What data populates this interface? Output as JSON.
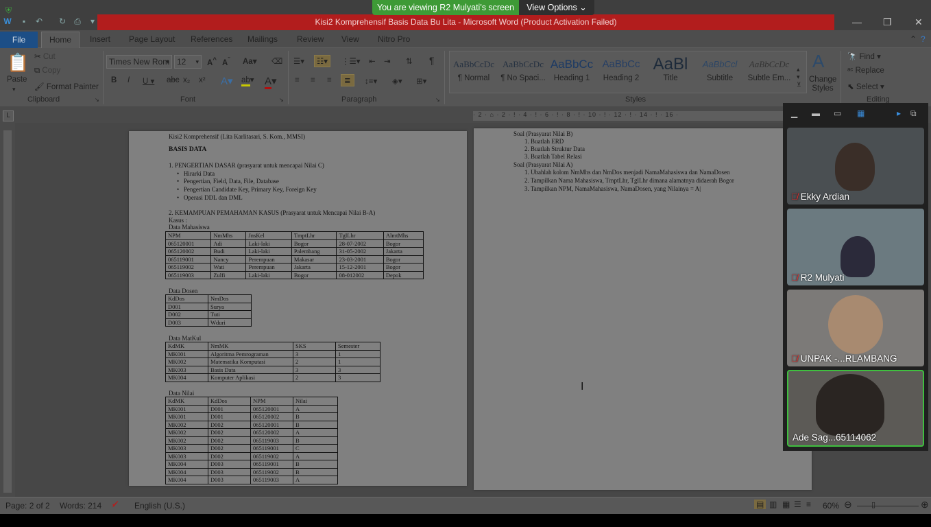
{
  "share": {
    "banner": "You are viewing R2 Mulyati's screen",
    "view_options": "View Options"
  },
  "window": {
    "title": "Kisi2 Komprehensif Basis Data Bu Lita - Microsoft Word (Product Activation Failed)"
  },
  "tabs": [
    "File",
    "Home",
    "Insert",
    "Page Layout",
    "References",
    "Mailings",
    "Review",
    "View",
    "Nitro Pro"
  ],
  "ribbon": {
    "clipboard": {
      "label": "Clipboard",
      "paste": "Paste",
      "cut": "Cut",
      "copy": "Copy",
      "format_painter": "Format Painter"
    },
    "font": {
      "label": "Font",
      "name": "Times New Rom",
      "size": "12"
    },
    "paragraph": {
      "label": "Paragraph"
    },
    "styles": {
      "label": "Styles",
      "items": [
        {
          "preview": "AaBbCcDc",
          "name": "¶ Normal"
        },
        {
          "preview": "AaBbCcDc",
          "name": "¶ No Spaci..."
        },
        {
          "preview": "AaBbCc",
          "name": "Heading 1"
        },
        {
          "preview": "AaBbCc",
          "name": "Heading 2"
        },
        {
          "preview": "AaBl",
          "name": "Title"
        },
        {
          "preview": "AaBbCcl",
          "name": "Subtitle"
        },
        {
          "preview": "AaBbCcDc",
          "name": "Subtle Em..."
        }
      ],
      "change_styles": "Change Styles"
    },
    "editing": {
      "label": "Editing",
      "find": "Find",
      "replace": "Replace",
      "select": "Select"
    }
  },
  "ruler": {
    "marks": "· 2 · ⌂ · 2 · ! · 4 · ! · 6 · ! · 8 · ! · 10 · ! · 12 · ! · 14 · ! · 16 ·"
  },
  "page1": {
    "header": "Kisi2 Komprehensif (Lita Karlitasari, S. Kom., MMSI)",
    "title": "BASIS DATA",
    "sec1": "1. PENGERTIAN DASAR (prasyarat untuk mencapai Nilai C)",
    "bullets": [
      "Hirarki Data",
      "Pengertian, Field, Data, File, Database",
      "Pengertian Candidate Key, Primary Key, Foreign Key",
      "Operasi  DDL dan DML"
    ],
    "sec2": "2. KEMAMPUAN PEMAHAMAN KASUS (Prasyarat untuk Mencapai Nilai B-A)",
    "kasus": "Kasus :",
    "mhs_title": "Data Mahasiswa",
    "mhs_header": [
      "NPM",
      "NmMhs",
      "JnsKel",
      "TmptLhr",
      "TglLhr",
      "AlmtMhs"
    ],
    "mhs_rows": [
      [
        "065120001",
        "Adi",
        "Laki-laki",
        "Bogor",
        "28-07-2002",
        "Bogor"
      ],
      [
        "065120002",
        "Budi",
        "Laki-laki",
        "Palembang",
        "31-05-2002",
        "Jakarta"
      ],
      [
        "065119001",
        "Nancy",
        "Perempuan",
        "Makasar",
        "23-03-2001",
        "Bogor"
      ],
      [
        "065119002",
        "Wati",
        "Perempuan",
        "Jakarta",
        "15-12-2001",
        "Bogor"
      ],
      [
        "065119003",
        "Zulfi",
        "Laki-laki",
        "Bogor",
        "08-012002",
        "Depok"
      ]
    ],
    "dosen_title": "Data Dosen",
    "dosen_header": [
      "KdDos",
      "NmDos"
    ],
    "dosen_rows": [
      [
        "D001",
        "Surya"
      ],
      [
        "D002",
        "Tuti"
      ],
      [
        "D003",
        "Wduri"
      ]
    ],
    "mk_title": "Data MatKul",
    "mk_header": [
      "KdMK",
      "NmMK",
      "SKS",
      "Semester"
    ],
    "mk_rows": [
      [
        "MK001",
        "Algoritma Pemrograman",
        "3",
        "1"
      ],
      [
        "MK002",
        "Matematika Komputasi",
        "2",
        "1"
      ],
      [
        "MK003",
        "Basis Data",
        "3",
        "3"
      ],
      [
        "MK004",
        "Komputer Aplikasi",
        "2",
        "3"
      ]
    ],
    "nilai_title": "Data Nilai",
    "nilai_header": [
      "KdMK",
      "KdDos",
      "NPM",
      "Nilai"
    ],
    "nilai_rows": [
      [
        "MK001",
        "D001",
        "065120001",
        "A"
      ],
      [
        "MK001",
        "D001",
        "065120002",
        "B"
      ],
      [
        "MK002",
        "D002",
        "065120001",
        "B"
      ],
      [
        "MK002",
        "D002",
        "065120002",
        "A"
      ],
      [
        "MK002",
        "D002",
        "065119003",
        "B"
      ],
      [
        "MK003",
        "D002",
        "065119001",
        "C"
      ],
      [
        "MK003",
        "D002",
        "065119002",
        "A"
      ],
      [
        "MK004",
        "D003",
        "065119001",
        "B"
      ],
      [
        "MK004",
        "D003",
        "065119002",
        "B"
      ],
      [
        "MK004",
        "D003",
        "065119003",
        "A"
      ]
    ]
  },
  "page2": {
    "soal_b": "Soal (Prasyarat Nilai B)",
    "soal_b_items": [
      "1.   Buatlah ERD",
      "2.   Buatlah Struktur Data",
      "3.   Buatlah Tabel Relasi"
    ],
    "soal_a": "Soal (Prasyarat Nilai A)",
    "soal_a_items": [
      "1.   Ubahlah kolom NmMhs dan NmDos menjadi NamaMahasiswa dan NamaDosen",
      "2.   Tampilkan Nama Mahasiswa, TmptLhr, TglLhr dimana alamatnya didaerah Bogor",
      "3.   Tampilkan NPM, NamaMahasiswa, NamaDosen, yang Nilainya = A|"
    ]
  },
  "status": {
    "page": "Page: 2 of 2",
    "words": "Words: 214",
    "language": "English (U.S.)",
    "zoom": "60%"
  },
  "participants": [
    {
      "name": "Ekky Ardian",
      "muted": true,
      "bg": "#4a4f52"
    },
    {
      "name": "R2 Mulyati",
      "muted": true,
      "bg": "#6b7a80"
    },
    {
      "name": "UNPAK -...RLAMBANG",
      "muted": true,
      "bg": "#7c7a78"
    },
    {
      "name": "Ade Sag...65114062",
      "muted": false,
      "bg": "#5c5a56"
    }
  ],
  "colors": {
    "title_red": "#b21d1d",
    "share_green": "#3e9a36",
    "active_speaker": "#3fbf3f"
  }
}
